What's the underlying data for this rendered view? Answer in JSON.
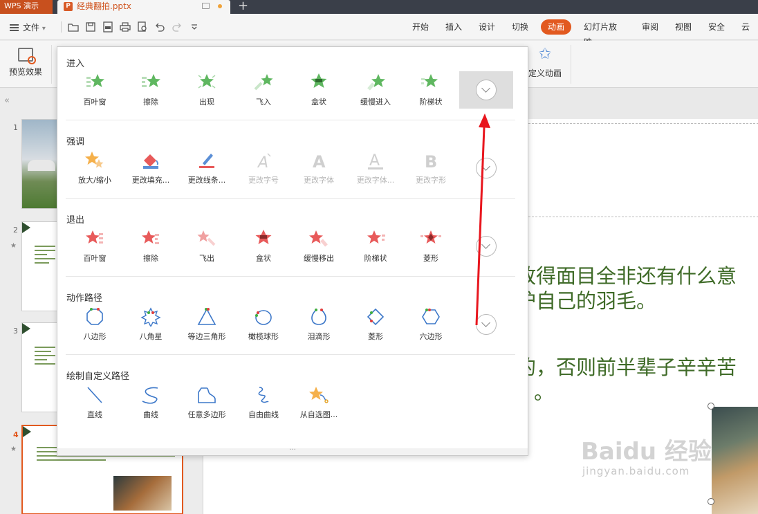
{
  "titlebar": {
    "app_name": "WPS 演示",
    "doc_name": "经典翻拍.pptx",
    "ppt_badge": "P",
    "new_tab": "+"
  },
  "menubar": {
    "file_label": "文件",
    "tabs": [
      "开始",
      "插入",
      "设计",
      "切换",
      "动画",
      "幻灯片放映",
      "审阅",
      "视图",
      "安全",
      "云"
    ],
    "active_tab": "动画"
  },
  "ribbon": {
    "preview_label": "预览效果",
    "custom_anim_label": "定义动画"
  },
  "slides_pane": {
    "collapse_glyph": "«",
    "numbers": [
      "1",
      "2",
      "3",
      "4"
    ],
    "active": "4"
  },
  "slide": {
    "line1": "放得面目全非还有什么意",
    "line2": "护自己的羽毛。",
    "line3": "的，否则前半辈子辛辛苦",
    "line4": "。"
  },
  "watermark": {
    "main": "Baidu 经验",
    "sub": "jingyan.baidu.com"
  },
  "panel": {
    "grip": "···",
    "sections": [
      {
        "title": "进入",
        "items": [
          {
            "label": "百叶窗",
            "icon": "star-blinds-green-icon",
            "disabled": false
          },
          {
            "label": "擦除",
            "icon": "star-wipe-green-icon",
            "disabled": false
          },
          {
            "label": "出现",
            "icon": "star-burst-green-icon",
            "disabled": false
          },
          {
            "label": "飞入",
            "icon": "star-fly-green-icon",
            "disabled": false
          },
          {
            "label": "盒状",
            "icon": "star-box-green-icon",
            "disabled": false
          },
          {
            "label": "缓慢进入",
            "icon": "star-slow-green-icon",
            "disabled": false
          },
          {
            "label": "阶梯状",
            "icon": "star-steps-green-icon",
            "disabled": false
          }
        ]
      },
      {
        "title": "强调",
        "items": [
          {
            "label": "放大/缩小",
            "icon": "star-grow-orange-icon",
            "disabled": false
          },
          {
            "label": "更改填充...",
            "icon": "paint-bucket-icon",
            "disabled": false
          },
          {
            "label": "更改线条...",
            "icon": "pen-line-icon",
            "disabled": false
          },
          {
            "label": "更改字号",
            "icon": "font-size-icon",
            "disabled": true
          },
          {
            "label": "更改字体",
            "icon": "font-a-icon",
            "disabled": true
          },
          {
            "label": "更改字体...",
            "icon": "font-a-underline-icon",
            "disabled": true
          },
          {
            "label": "更改字形",
            "icon": "font-b-icon",
            "disabled": true
          }
        ]
      },
      {
        "title": "退出",
        "items": [
          {
            "label": "百叶窗",
            "icon": "star-blinds-red-icon",
            "disabled": false
          },
          {
            "label": "擦除",
            "icon": "star-wipe-red-icon",
            "disabled": false
          },
          {
            "label": "飞出",
            "icon": "star-fly-red-icon",
            "disabled": false
          },
          {
            "label": "盒状",
            "icon": "star-box-red-icon",
            "disabled": false
          },
          {
            "label": "缓慢移出",
            "icon": "star-slow-red-icon",
            "disabled": false
          },
          {
            "label": "阶梯状",
            "icon": "star-steps-red-icon",
            "disabled": false
          },
          {
            "label": "菱形",
            "icon": "star-diamond-red-icon",
            "disabled": false
          }
        ]
      },
      {
        "title": "动作路径",
        "items": [
          {
            "label": "八边形",
            "icon": "octagon-path-icon",
            "disabled": false
          },
          {
            "label": "八角星",
            "icon": "eight-point-star-path-icon",
            "disabled": false
          },
          {
            "label": "等边三角形",
            "icon": "triangle-path-icon",
            "disabled": false
          },
          {
            "label": "橄榄球形",
            "icon": "football-path-icon",
            "disabled": false
          },
          {
            "label": "泪滴形",
            "icon": "teardrop-path-icon",
            "disabled": false
          },
          {
            "label": "菱形",
            "icon": "diamond-path-icon",
            "disabled": false
          },
          {
            "label": "六边形",
            "icon": "hexagon-path-icon",
            "disabled": false
          }
        ]
      },
      {
        "title": "绘制自定义路径",
        "items": [
          {
            "label": "直线",
            "icon": "straight-line-icon",
            "disabled": false
          },
          {
            "label": "曲线",
            "icon": "curve-icon",
            "disabled": false
          },
          {
            "label": "任意多边形",
            "icon": "freeform-polygon-icon",
            "disabled": false
          },
          {
            "label": "自由曲线",
            "icon": "scribble-icon",
            "disabled": false
          },
          {
            "label": "从自选图...",
            "icon": "star-from-shape-icon",
            "disabled": false
          }
        ]
      }
    ]
  },
  "colors": {
    "accent": "#e2591f",
    "enter_green": "#5fb760",
    "exit_red": "#e85a5a",
    "emphasis_orange": "#f0a33a",
    "path_blue": "#3d78c9",
    "slide_text": "#3f6b28",
    "annotation_red": "#e8161e"
  }
}
